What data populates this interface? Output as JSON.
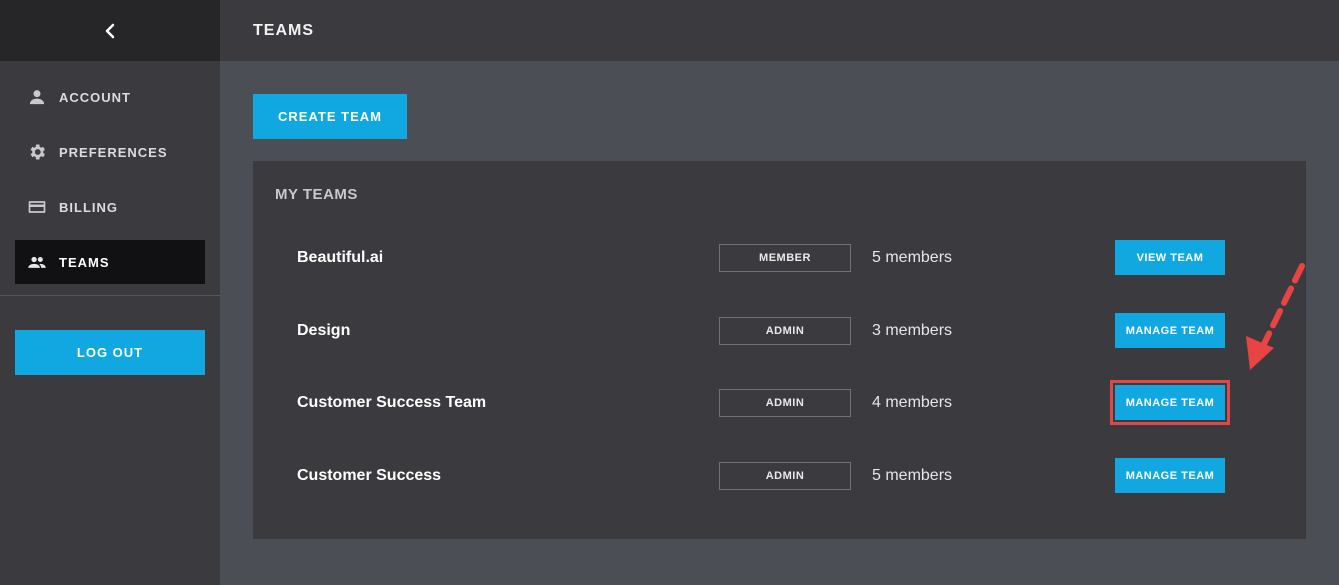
{
  "sidebar": {
    "back_icon": "chevron-left-icon",
    "items": [
      {
        "label": "ACCOUNT",
        "icon": "person-icon",
        "active": false
      },
      {
        "label": "PREFERENCES",
        "icon": "gear-icon",
        "active": false
      },
      {
        "label": "BILLING",
        "icon": "credit-card-icon",
        "active": false
      },
      {
        "label": "TEAMS",
        "icon": "people-icon",
        "active": true
      }
    ],
    "logout_label": "LOG OUT"
  },
  "header": {
    "title": "TEAMS"
  },
  "main": {
    "create_team_label": "CREATE TEAM",
    "panel_title": "MY TEAMS",
    "teams": [
      {
        "name": "Beautiful.ai",
        "role": "MEMBER",
        "members": "5 members",
        "action": "VIEW TEAM",
        "highlighted": false
      },
      {
        "name": "Design",
        "role": "ADMIN",
        "members": "3 members",
        "action": "MANAGE TEAM",
        "highlighted": false
      },
      {
        "name": "Customer Success Team",
        "role": "ADMIN",
        "members": "4 members",
        "action": "MANAGE TEAM",
        "highlighted": true
      },
      {
        "name": "Customer Success",
        "role": "ADMIN",
        "members": "5 members",
        "action": "MANAGE TEAM",
        "highlighted": false
      }
    ]
  },
  "colors": {
    "accent": "#11a8e2",
    "highlight": "#e04848",
    "sidebar_bg": "#3b3b3f",
    "page_bg": "#4c4e56"
  }
}
